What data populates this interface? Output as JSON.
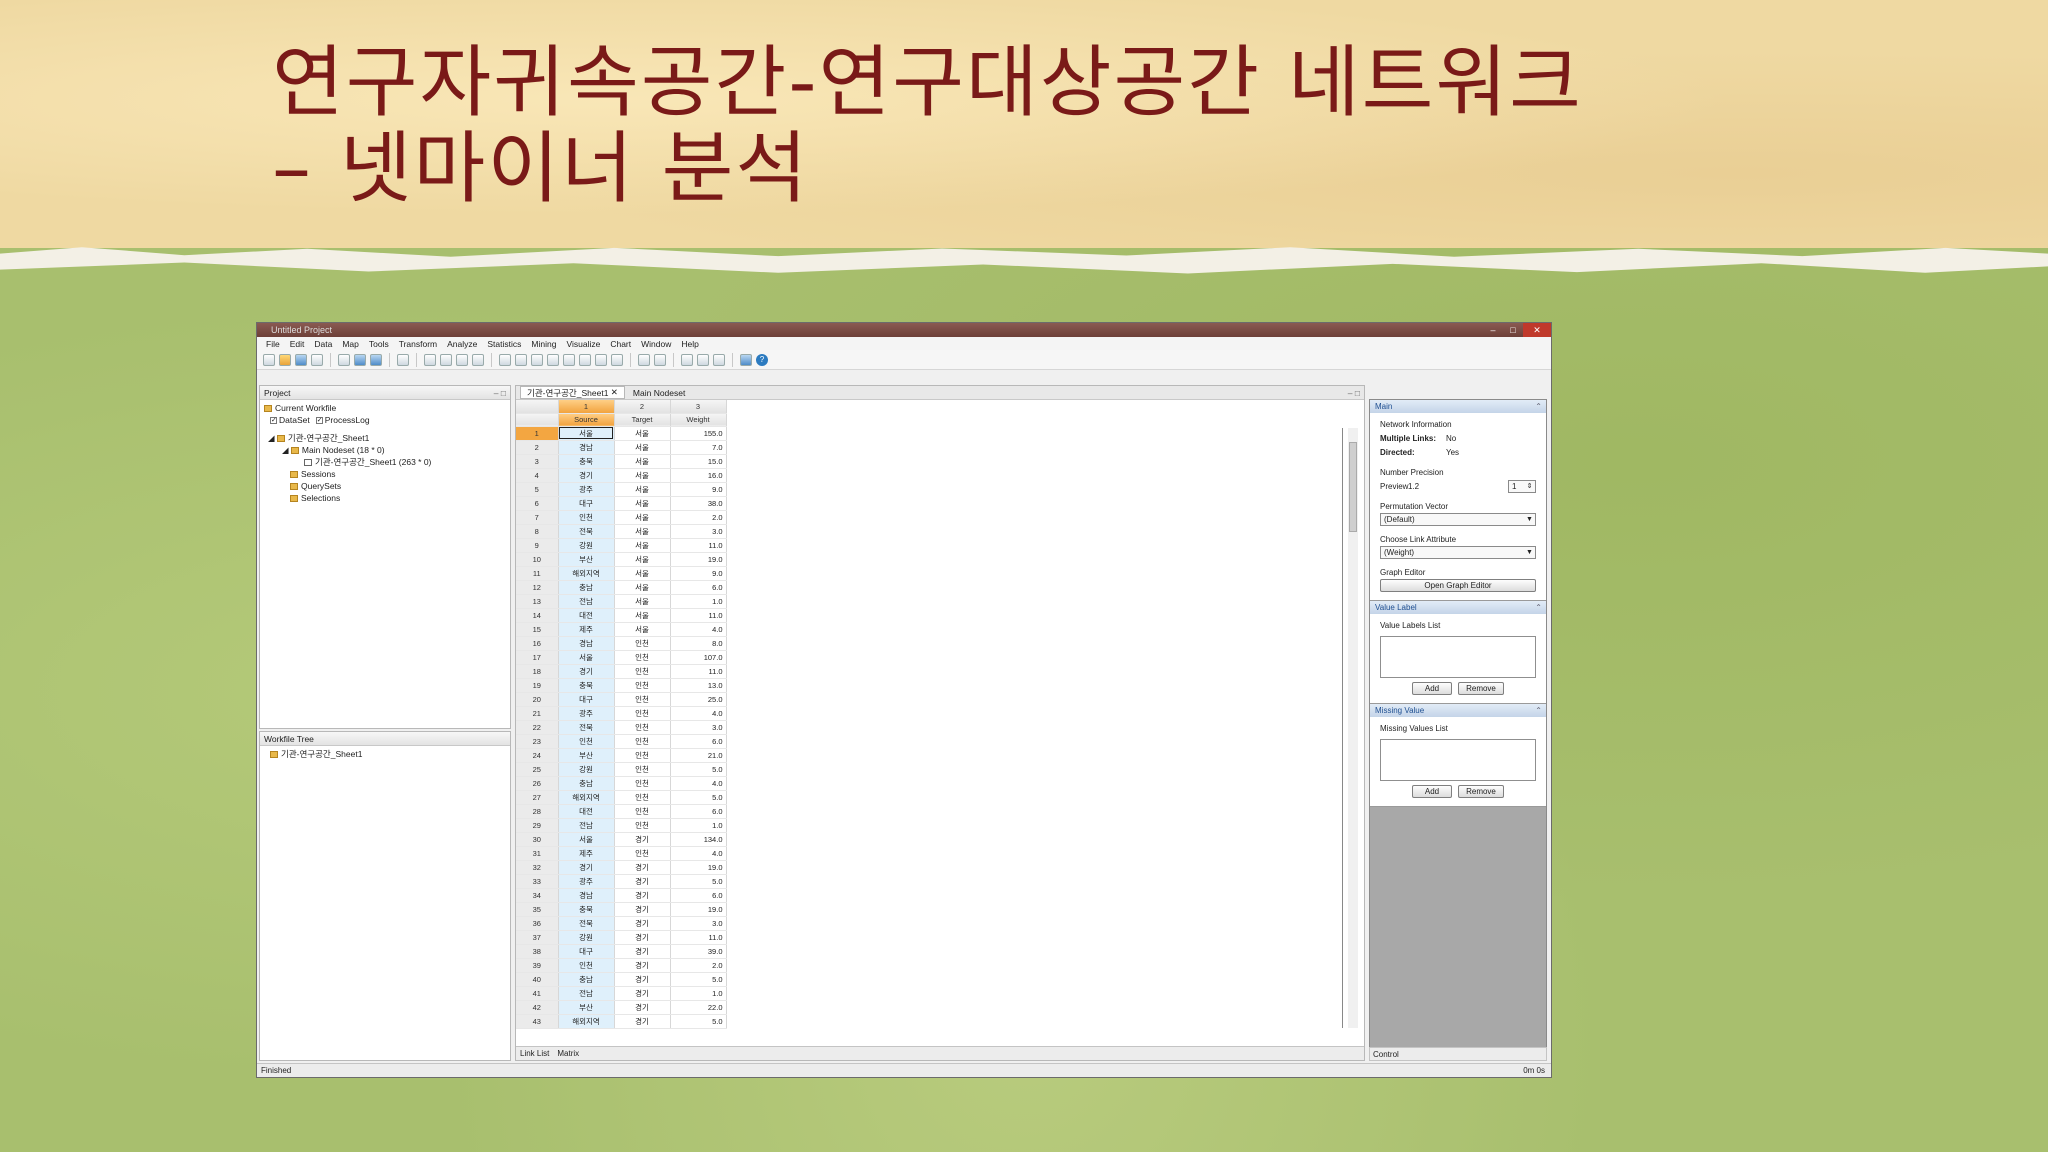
{
  "slide": {
    "title_line1": "연구자귀속공간-연구대상공간 네트워크",
    "title_line2": "– 넷마이너 분석",
    "title_color": "#7a1a18"
  },
  "app": {
    "window_title": "Untitled Project",
    "menu": [
      "File",
      "Edit",
      "Data",
      "Map",
      "Tools",
      "Transform",
      "Analyze",
      "Statistics",
      "Mining",
      "Visualize",
      "Chart",
      "Window",
      "Help"
    ],
    "project_panel": {
      "title": "Project",
      "workfile_label": "Current Workfile",
      "dataset_label": "DataSet",
      "processlog_label": "ProcessLog",
      "tree": [
        "기관-연구공간_Sheet1",
        "Main Nodeset (18 * 0)",
        "기관-연구공간_Sheet1 (263 * 0)",
        "Sessions",
        "QuerySets",
        "Selections"
      ]
    },
    "workfile_tree": {
      "title": "Workfile Tree",
      "item": "기관-연구공간_Sheet1"
    },
    "tabs": {
      "active": "기관-연구공간_Sheet1",
      "other": "Main Nodeset"
    },
    "table": {
      "col_numbers": [
        "1",
        "2",
        "3"
      ],
      "headers": [
        "Source",
        "Target",
        "Weight"
      ],
      "rows": [
        [
          "서울",
          "서울",
          "155.0"
        ],
        [
          "경남",
          "서울",
          "7.0"
        ],
        [
          "충북",
          "서울",
          "15.0"
        ],
        [
          "경기",
          "서울",
          "16.0"
        ],
        [
          "광주",
          "서울",
          "9.0"
        ],
        [
          "대구",
          "서울",
          "38.0"
        ],
        [
          "인천",
          "서울",
          "2.0"
        ],
        [
          "전북",
          "서울",
          "3.0"
        ],
        [
          "강원",
          "서울",
          "11.0"
        ],
        [
          "부산",
          "서울",
          "19.0"
        ],
        [
          "해외지역",
          "서울",
          "9.0"
        ],
        [
          "충남",
          "서울",
          "6.0"
        ],
        [
          "전남",
          "서울",
          "1.0"
        ],
        [
          "대전",
          "서울",
          "11.0"
        ],
        [
          "제주",
          "서울",
          "4.0"
        ],
        [
          "경남",
          "인천",
          "8.0"
        ],
        [
          "서울",
          "인천",
          "107.0"
        ],
        [
          "경기",
          "인천",
          "11.0"
        ],
        [
          "충북",
          "인천",
          "13.0"
        ],
        [
          "대구",
          "인천",
          "25.0"
        ],
        [
          "광주",
          "인천",
          "4.0"
        ],
        [
          "전북",
          "인천",
          "3.0"
        ],
        [
          "인천",
          "인천",
          "6.0"
        ],
        [
          "부산",
          "인천",
          "21.0"
        ],
        [
          "강원",
          "인천",
          "5.0"
        ],
        [
          "충남",
          "인천",
          "4.0"
        ],
        [
          "해외지역",
          "인천",
          "5.0"
        ],
        [
          "대전",
          "인천",
          "6.0"
        ],
        [
          "전남",
          "인천",
          "1.0"
        ],
        [
          "서울",
          "경기",
          "134.0"
        ],
        [
          "제주",
          "인천",
          "4.0"
        ],
        [
          "경기",
          "경기",
          "19.0"
        ],
        [
          "광주",
          "경기",
          "5.0"
        ],
        [
          "경남",
          "경기",
          "6.0"
        ],
        [
          "충북",
          "경기",
          "19.0"
        ],
        [
          "전북",
          "경기",
          "3.0"
        ],
        [
          "강원",
          "경기",
          "11.0"
        ],
        [
          "대구",
          "경기",
          "39.0"
        ],
        [
          "인천",
          "경기",
          "2.0"
        ],
        [
          "충남",
          "경기",
          "5.0"
        ],
        [
          "전남",
          "경기",
          "1.0"
        ],
        [
          "부산",
          "경기",
          "22.0"
        ],
        [
          "해외지역",
          "경기",
          "5.0"
        ]
      ],
      "bottom_tabs": [
        "Link List",
        "Matrix"
      ]
    },
    "main_panel": {
      "title": "Main",
      "network_info": "Network Information",
      "multiple_links_label": "Multiple Links:",
      "multiple_links_value": "No",
      "directed_label": "Directed:",
      "directed_value": "Yes",
      "number_precision": "Number Precision",
      "preview_label": "Preview",
      "preview_value": "1.2",
      "precision_value": "1",
      "permutation_label": "Permutation Vector",
      "permutation_value": "(Default)",
      "link_attr_label": "Choose Link Attribute",
      "link_attr_value": "(Weight)",
      "graph_editor_label": "Graph Editor",
      "graph_editor_button": "Open Graph Editor"
    },
    "value_label_panel": {
      "title": "Value Label",
      "list_label": "Value Labels List",
      "add": "Add",
      "remove": "Remove"
    },
    "missing_value_panel": {
      "title": "Missing Value",
      "list_label": "Missing Values List",
      "add": "Add",
      "remove": "Remove"
    },
    "control_tab": "Control",
    "status_left": "Finished",
    "status_right": "0m 0s"
  }
}
